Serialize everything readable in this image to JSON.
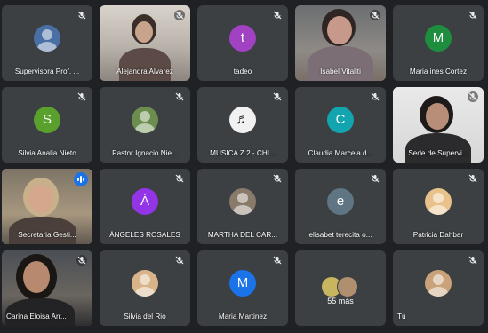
{
  "participants": [
    {
      "name": "Supervisora Prof. ...",
      "avatar_type": "photo",
      "avatar_color": "#4a6fa5",
      "mic": "muted"
    },
    {
      "name": "Alejandra Alvarez",
      "avatar_type": "video",
      "mic": "muted"
    },
    {
      "name": "tadeo",
      "avatar_type": "letter",
      "initial": "t",
      "avatar_color": "#a142c2",
      "mic": "muted"
    },
    {
      "name": "Isabel Vitaliti",
      "avatar_type": "video",
      "mic": "muted"
    },
    {
      "name": "Maria ines Cortez",
      "avatar_type": "letter",
      "initial": "M",
      "avatar_color": "#1e8e3e",
      "mic": "muted"
    },
    {
      "name": "Silvia Analia Nieto",
      "avatar_type": "letter",
      "initial": "S",
      "avatar_color": "#5aa02c",
      "mic": "muted"
    },
    {
      "name": "Pastor Ignacio Nie...",
      "avatar_type": "photo",
      "avatar_color": "#6b8e4e",
      "mic": "muted"
    },
    {
      "name": "MUSICA Z 2 - CHI...",
      "avatar_type": "photo",
      "avatar_color": "#f1f1f1",
      "mic": "muted"
    },
    {
      "name": "Claudia Marcela d...",
      "avatar_type": "letter",
      "initial": "C",
      "avatar_color": "#12a4af",
      "mic": "muted"
    },
    {
      "name": "Sede de Supervi...",
      "avatar_type": "video",
      "mic": "muted"
    },
    {
      "name": "Secretaria Gesti...",
      "avatar_type": "video",
      "mic": "speaking"
    },
    {
      "name": "ÁNGELES ROSALES",
      "avatar_type": "letter",
      "initial": "Á",
      "avatar_color": "#9334e6",
      "mic": "muted"
    },
    {
      "name": "MARTHA DEL CAR...",
      "avatar_type": "photo",
      "avatar_color": "#8a7a6a",
      "mic": "muted"
    },
    {
      "name": "elisabet terecita o...",
      "avatar_type": "letter",
      "initial": "e",
      "avatar_color": "#5f7583",
      "mic": "muted"
    },
    {
      "name": "Patricia Dahbar",
      "avatar_type": "photo",
      "avatar_color": "#e8c28a",
      "mic": "muted"
    },
    {
      "name": "Carina Eloisa Arr...",
      "avatar_type": "video",
      "mic": "muted"
    },
    {
      "name": "Silvia del Rio",
      "avatar_type": "photo",
      "avatar_color": "#d9b48a",
      "mic": "muted"
    },
    {
      "name": "Maria Martinez",
      "avatar_type": "letter",
      "initial": "M",
      "avatar_color": "#1a73e8",
      "mic": "muted"
    },
    {
      "name": "",
      "avatar_type": "more",
      "mic": "none"
    },
    {
      "name": "Tú",
      "avatar_type": "photo",
      "avatar_color": "#c9a27a",
      "mic": "muted"
    }
  ],
  "more_tile": {
    "label": "55 más",
    "colors": [
      "#c8b560",
      "#b08f70"
    ]
  },
  "colors": {
    "background": "#202124",
    "tile": "#3c4043",
    "speaking": "#1a73e8"
  }
}
